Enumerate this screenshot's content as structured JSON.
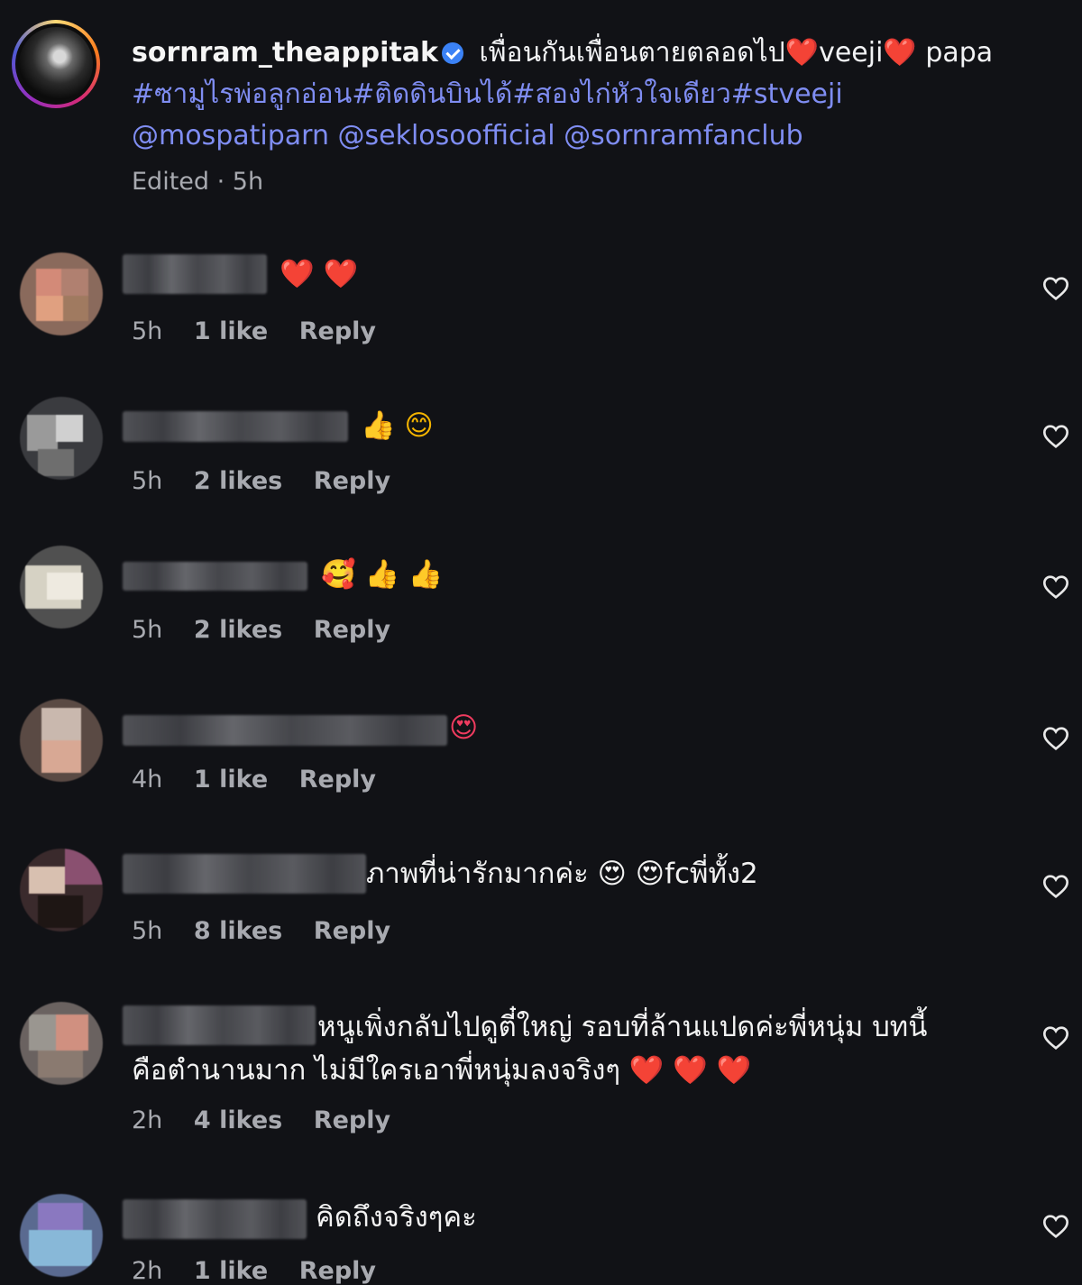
{
  "caption": {
    "username": "sornram_theappitak",
    "text_line1_a": "เพื่อนกันเพื่อนตายตลอดไป",
    "heart1": "❤️",
    "text_line1_b": "veeji",
    "heart2": "❤️",
    "text_line1_c": "papa",
    "hashtags": "#ซามูไรพ่อลูกอ่อน#ติดดินบินได้#สองไก่หัวใจเดียว#stveeji",
    "mentions": "@mospatiparn @seklosoofficial @sornramfanclub",
    "meta": "Edited · 5h"
  },
  "comments": [
    {
      "text": "❤️ ❤️",
      "time": "5h",
      "likes": "1 like",
      "reply": "Reply"
    },
    {
      "text": "👍 😊",
      "time": "5h",
      "likes": "2 likes",
      "reply": "Reply"
    },
    {
      "text": "🥰 👍 👍",
      "time": "5h",
      "likes": "2 likes",
      "reply": "Reply"
    },
    {
      "text": "😍",
      "time": "4h",
      "likes": "1 like",
      "reply": "Reply"
    },
    {
      "text": "ภาพที่น่ารักมากค่ะ 😍 😍fcพี่ทั้ง2",
      "time": "5h",
      "likes": "8 likes",
      "reply": "Reply"
    },
    {
      "text_line1": "หนูเพิ่งกลับไปดูตี๋ใหญ่ รอบที่ล้านแปดค่ะพี่หนุ่ม บทนี้",
      "text_line2": "คือตำนานมาก ไม่มีใครเอาพี่หนุ่มลงจริงๆ ❤️ ❤️ ❤️",
      "time": "2h",
      "likes": "4 likes",
      "reply": "Reply"
    },
    {
      "text": "คิดถึงจริงๆคะ",
      "time": "2h",
      "likes": "1 like",
      "reply": "Reply"
    }
  ],
  "icons": {
    "like": "heart-outline-icon",
    "verified": "verified-badge-icon"
  },
  "colors": {
    "background": "#111216",
    "link": "#7f8df2",
    "meta": "#a8aab0",
    "heart": "#ef3b5f"
  }
}
